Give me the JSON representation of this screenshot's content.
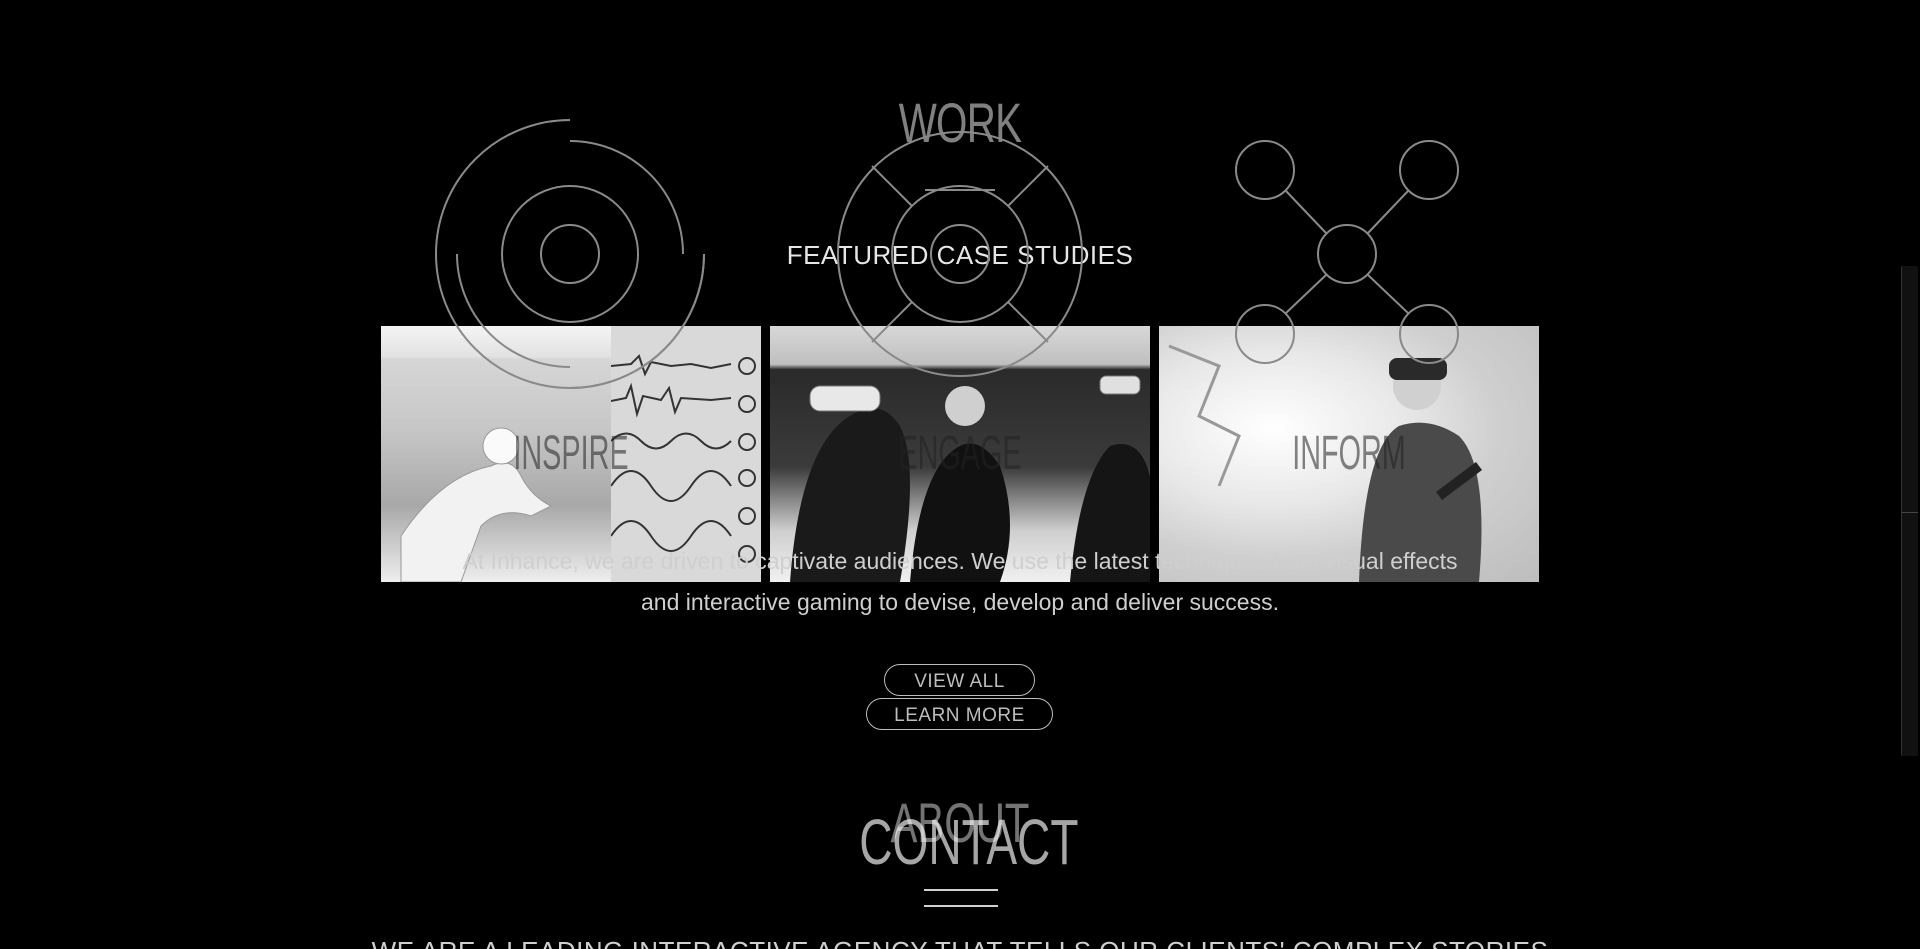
{
  "sections": {
    "work_title": "WORK",
    "featured_title": "FEATURED CASE STUDIES",
    "about_title": "ABOUT",
    "contact_title": "CONTACT"
  },
  "cards": [
    {
      "label": "INSPIRE",
      "icon": "target-circles-icon"
    },
    {
      "label": "ENGAGE",
      "icon": "lifebuoy-icon"
    },
    {
      "label": "INFORM",
      "icon": "network-nodes-icon"
    }
  ],
  "description": {
    "line1": "At Inhance, we are driven to captivate audiences. We use the latest techniques from visual effects",
    "line2": "and interactive gaming to devise, develop and deliver success."
  },
  "buttons": {
    "view_all": "VIEW ALL",
    "learn_more": "LEARN MORE"
  },
  "bottom_text": "WE ARE A LEADING INTERACTIVE AGENCY THAT TELLS OUR CLIENTS' COMPLEX STORIES",
  "colors": {
    "background": "#000000",
    "text": "#ffffff",
    "muted": "#cfcfcf",
    "icon_stroke": "#8a8a8a"
  }
}
